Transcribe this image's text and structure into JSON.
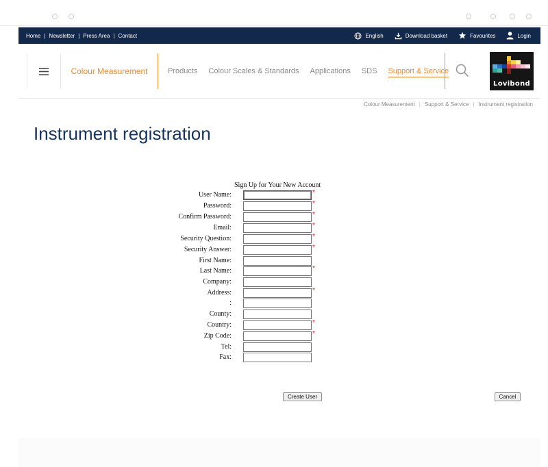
{
  "topbar": {
    "links": [
      "Home",
      "Newsletter",
      "Press Area",
      "Contact"
    ],
    "language": "English",
    "download_basket": "Download basket",
    "favourites": "Favourites",
    "login": "Login"
  },
  "header": {
    "brand": "Colour Measurement",
    "nav": [
      "Products",
      "Colour Scales & Standards",
      "Applications",
      "SDS",
      "Support & Service"
    ],
    "active_nav": "Support & Service",
    "logo_text": "Lovibond"
  },
  "breadcrumb": [
    "Colour Measurement",
    "Support & Service",
    "Instrument registration"
  ],
  "page_title": "Instrument registration",
  "form": {
    "caption": "Sign Up for Your New Account",
    "fields": [
      {
        "label": "User Name:",
        "required": true
      },
      {
        "label": "Password:",
        "required": true
      },
      {
        "label": "Confirm Password:",
        "required": true
      },
      {
        "label": "Email:",
        "required": true
      },
      {
        "label": "Security Question:",
        "required": true
      },
      {
        "label": "Security Answer:",
        "required": true
      },
      {
        "label": "First Name:",
        "required": false
      },
      {
        "label": "Last Name:",
        "required": true
      },
      {
        "label": "Company:",
        "required": false
      },
      {
        "label": "Address:",
        "required": true
      },
      {
        "label": ":",
        "required": false
      },
      {
        "label": "County:",
        "required": false
      },
      {
        "label": "Country:",
        "required": true
      },
      {
        "label": "Zip Code:",
        "required": true
      },
      {
        "label": "Tel:",
        "required": false
      },
      {
        "label": "Fax:",
        "required": false
      }
    ],
    "required_marker": "*",
    "create_label": "Create User",
    "cancel_label": "Cancel"
  },
  "colors": {
    "navy": "#13294b",
    "orange": "#e98e2e",
    "title_blue": "#16355e",
    "required_red": "#e21b1b"
  }
}
